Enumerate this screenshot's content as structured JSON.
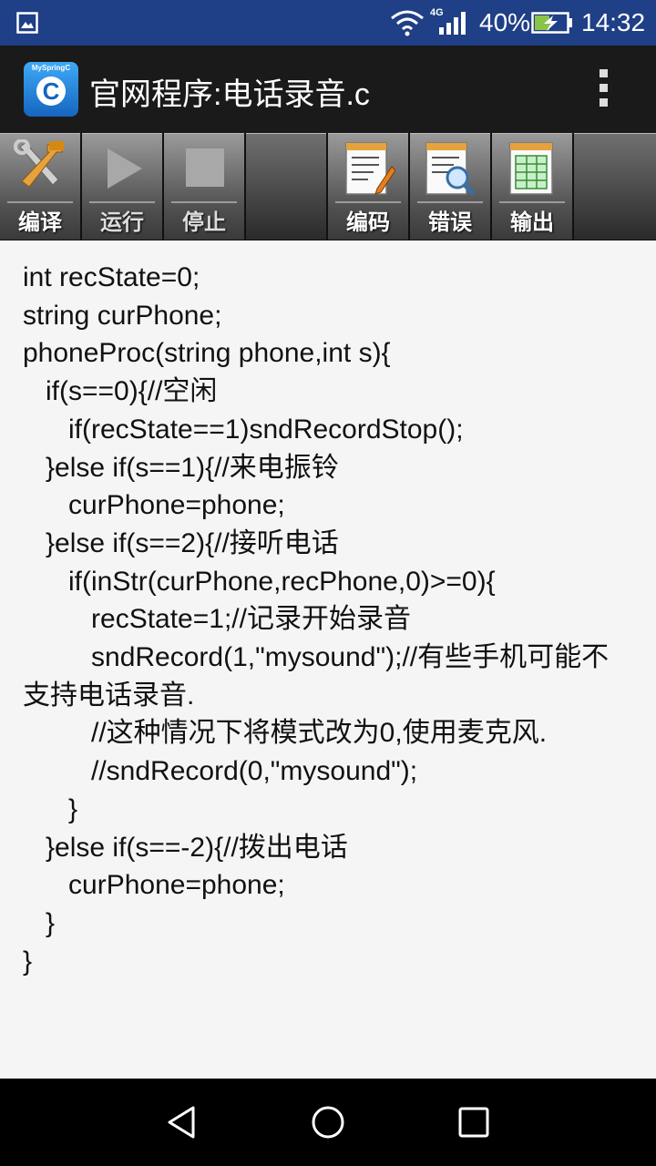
{
  "status_bar": {
    "network": "4G",
    "battery": "40%",
    "time": "14:32",
    "icons": [
      "gallery-icon",
      "wifi-icon",
      "signal-icon",
      "battery-charging-icon"
    ]
  },
  "app_bar": {
    "logo_text": "MySpringC",
    "logo_letter": "C",
    "title": "官网程序:电话录音.c"
  },
  "toolbar": {
    "compile": "编译",
    "run": "运行",
    "stop": "停止",
    "code": "编码",
    "errors": "错误",
    "output": "输出"
  },
  "editor": {
    "code": "int recState=0;\nstring curPhone;\nphoneProc(string phone,int s){\n   if(s==0){//空闲\n      if(recState==1)sndRecordStop();\n   }else if(s==1){//来电振铃\n      curPhone=phone;\n   }else if(s==2){//接听电话\n      if(inStr(curPhone,recPhone,0)>=0){\n         recState=1;//记录开始录音\n         sndRecord(1,\"mysound\");//有些手机可能不支持电话录音.\n         //这种情况下将模式改为0,使用麦克风.\n         //sndRecord(0,\"mysound\");\n      }\n   }else if(s==-2){//拨出电话\n      curPhone=phone;\n   }\n}"
  },
  "nav_bar": {
    "icons": [
      "back-icon",
      "home-icon",
      "recents-icon"
    ]
  }
}
